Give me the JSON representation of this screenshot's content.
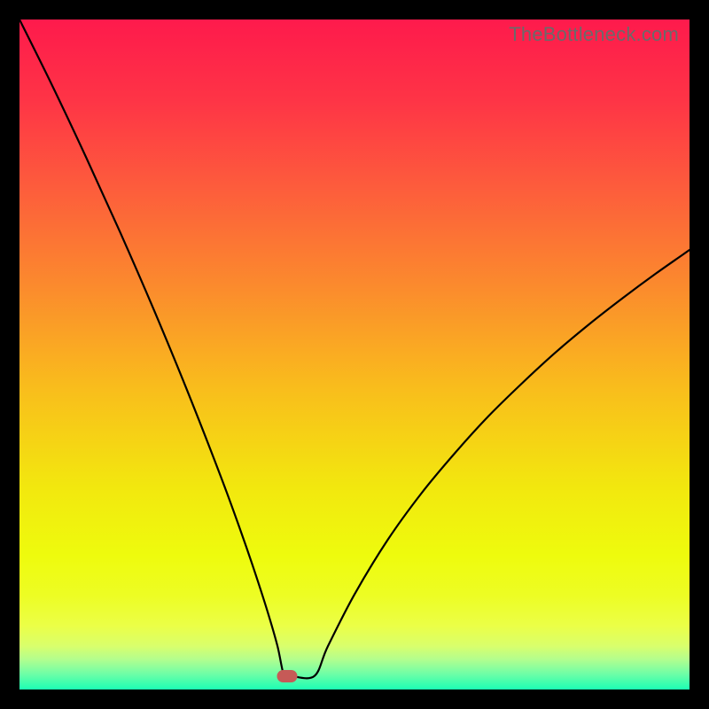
{
  "watermark": "TheBottleneck.com",
  "chart_data": {
    "type": "line",
    "title": "",
    "xlabel": "",
    "ylabel": "",
    "xlim": [
      0,
      100
    ],
    "ylim": [
      0,
      100
    ],
    "grid": false,
    "series": [
      {
        "name": "curve",
        "x": [
          0,
          5,
          10,
          15,
          20,
          25,
          30,
          33,
          35,
          37,
          38.5,
          39.5,
          40.5,
          44,
          46,
          50,
          55,
          60,
          65,
          70,
          75,
          80,
          85,
          90,
          95,
          100
        ],
        "values": [
          100,
          89.9,
          79.3,
          68.3,
          56.8,
          44.7,
          31.9,
          23.7,
          17.9,
          11.7,
          6.5,
          2,
          2,
          2,
          6.4,
          14.2,
          22.4,
          29.3,
          35.3,
          40.8,
          45.7,
          50.3,
          54.5,
          58.4,
          62.1,
          65.6
        ]
      }
    ],
    "background_gradient": {
      "stops": [
        {
          "offset": 0.0,
          "color": "#fe1a4c"
        },
        {
          "offset": 0.12,
          "color": "#fe3446"
        },
        {
          "offset": 0.25,
          "color": "#fd5c3c"
        },
        {
          "offset": 0.4,
          "color": "#fb8b2d"
        },
        {
          "offset": 0.55,
          "color": "#f9bd1c"
        },
        {
          "offset": 0.7,
          "color": "#f2e80e"
        },
        {
          "offset": 0.8,
          "color": "#eefb0d"
        },
        {
          "offset": 0.86,
          "color": "#edfd24"
        },
        {
          "offset": 0.905,
          "color": "#ebff47"
        },
        {
          "offset": 0.935,
          "color": "#d9ff6c"
        },
        {
          "offset": 0.955,
          "color": "#b3fe8e"
        },
        {
          "offset": 0.975,
          "color": "#74fea5"
        },
        {
          "offset": 1.0,
          "color": "#1cfeb4"
        }
      ]
    },
    "marker": {
      "x": 40.0,
      "y": 2,
      "color": "#c65a57"
    }
  }
}
